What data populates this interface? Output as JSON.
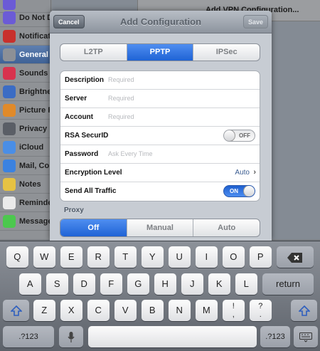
{
  "background": {
    "sidebar_items": [
      {
        "label": "",
        "icon": "moon-icon",
        "color": "#6b5bd6"
      },
      {
        "label": "Do Not D",
        "icon": "moon-icon",
        "color": "#6b5bd6"
      },
      {
        "label": "Notificat",
        "icon": "notifications-icon",
        "color": "#c8302c"
      },
      {
        "label": "General",
        "icon": "gear-icon",
        "color": "#8d9096"
      },
      {
        "label": "Sounds",
        "icon": "speaker-icon",
        "color": "#d8334e"
      },
      {
        "label": "Brightne",
        "icon": "sun-icon",
        "color": "#3b6cc4"
      },
      {
        "label": "Picture F",
        "icon": "flower-icon",
        "color": "#e08a2a"
      },
      {
        "label": "Privacy",
        "icon": "hand-icon",
        "color": "#5a5e66"
      },
      {
        "label": "iCloud",
        "icon": "cloud-icon",
        "color": "#4a8ee6"
      },
      {
        "label": "Mail, Co",
        "icon": "mail-icon",
        "color": "#3b82e0"
      },
      {
        "label": "Notes",
        "icon": "notes-icon",
        "color": "#e6c243"
      },
      {
        "label": "Reminde",
        "icon": "reminders-icon",
        "color": "#eaeaea"
      },
      {
        "label": "Message",
        "icon": "messages-icon",
        "color": "#4cc84e"
      }
    ],
    "selected_item": "General",
    "vpn_row_label": "Add VPN Configuration..."
  },
  "sheet": {
    "title": "Add Configuration",
    "cancel_label": "Cancel",
    "save_label": "Save",
    "protocol_tabs": [
      {
        "label": "L2TP",
        "selected": false
      },
      {
        "label": "PPTP",
        "selected": true
      },
      {
        "label": "IPSec",
        "selected": false
      }
    ],
    "fields": {
      "description": {
        "label": "Description",
        "placeholder": "Required"
      },
      "server": {
        "label": "Server",
        "placeholder": "Required"
      },
      "account": {
        "label": "Account",
        "placeholder": "Required"
      },
      "rsa": {
        "label": "RSA SecurID",
        "toggle": "OFF"
      },
      "password": {
        "label": "Password",
        "placeholder": "Ask Every Time"
      },
      "encryption": {
        "label": "Encryption Level",
        "value": "Auto"
      },
      "send_all": {
        "label": "Send All Traffic",
        "toggle": "ON"
      }
    },
    "proxy_label": "Proxy",
    "proxy_tabs": [
      {
        "label": "Off",
        "selected": true
      },
      {
        "label": "Manual",
        "selected": false
      },
      {
        "label": "Auto",
        "selected": false
      }
    ]
  },
  "keyboard": {
    "row1": [
      "Q",
      "W",
      "E",
      "R",
      "T",
      "Y",
      "U",
      "I",
      "O",
      "P"
    ],
    "row2": [
      "A",
      "S",
      "D",
      "F",
      "G",
      "H",
      "J",
      "K",
      "L"
    ],
    "row3": [
      "Z",
      "X",
      "C",
      "V",
      "B",
      "N",
      "M",
      "!\n,",
      "?\n."
    ],
    "return_label": "return",
    "numbers_label": ".?123",
    "icons": [
      "backspace-icon",
      "shift-icon",
      "microphone-icon",
      "hide-keyboard-icon"
    ]
  },
  "colors": {
    "accent": "#2a6ddf",
    "toggle_on": "#2f6fe0"
  }
}
